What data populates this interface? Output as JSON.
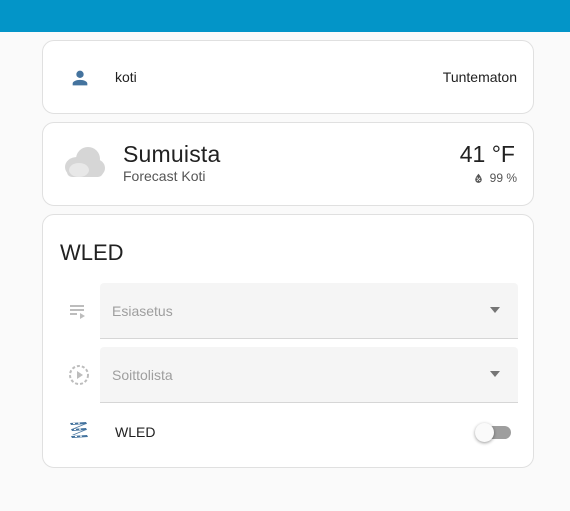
{
  "colors": {
    "header": "#0395c8",
    "person_icon": "#44739e",
    "wled_icon": "#44739e"
  },
  "person": {
    "icon": "person-icon",
    "name": "koti",
    "state": "Tuntematon"
  },
  "weather": {
    "icon": "cloud-icon",
    "condition": "Sumuista",
    "name": "Forecast Koti",
    "temperature": "41 °F",
    "humidity_icon": "water-percent-icon",
    "humidity": "99 %"
  },
  "wled": {
    "title": "WLED",
    "preset": {
      "icon": "playlist-play-icon",
      "label": "Esiasetus"
    },
    "playlist": {
      "icon": "play-speed-icon",
      "label": "Soittolista"
    },
    "switch": {
      "icon": "led-strip-icon",
      "label": "WLED",
      "state": "off"
    }
  }
}
